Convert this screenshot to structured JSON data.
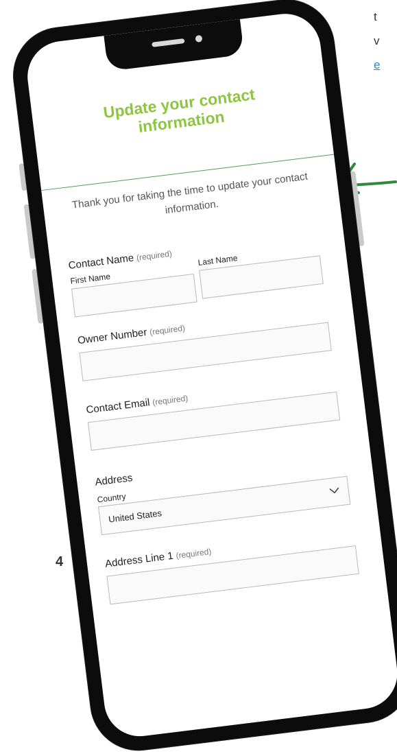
{
  "edge_text": {
    "line1": "t",
    "line2": "v",
    "link": "e"
  },
  "page_number": "4",
  "form": {
    "title": "Update your contact information",
    "intro": "Thank you for taking the time to update your contact information.",
    "required_text": "(required)",
    "contact_name": {
      "label": "Contact Name",
      "first_label": "First Name",
      "first_value": "",
      "last_label": "Last Name",
      "last_value": ""
    },
    "owner_number": {
      "label": "Owner Number",
      "value": ""
    },
    "contact_email": {
      "label": "Contact Email",
      "value": ""
    },
    "address": {
      "label": "Address",
      "country_label": "Country",
      "country_value": "United States",
      "line1_label": "Address Line 1",
      "line1_value": ""
    }
  },
  "colors": {
    "title_green": "#8cc63e",
    "divider_green": "#4f9c58",
    "arrow_green": "#2e8b3a",
    "link_blue": "#2f7fc1"
  },
  "icons": {
    "country_select": "chevron-down-icon",
    "arrow": "arrow-left-icon"
  }
}
